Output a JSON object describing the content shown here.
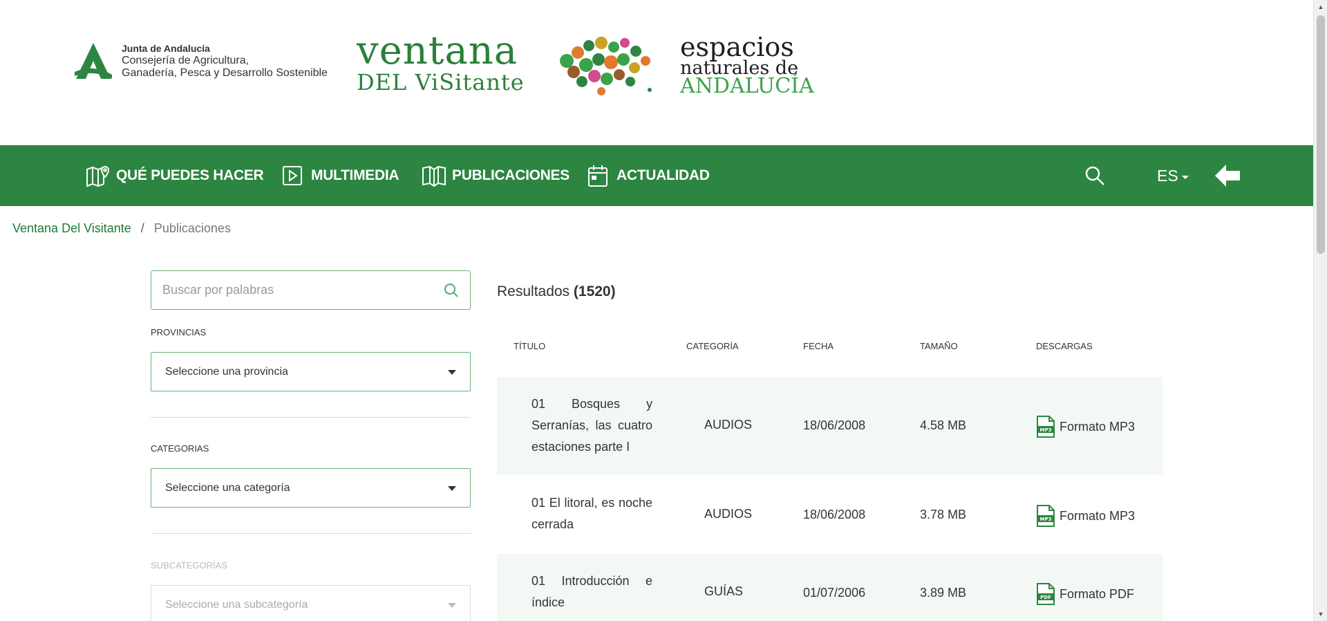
{
  "header": {
    "junta_line1": "Junta de Andalucía",
    "junta_line2": "Consejería de Agricultura,",
    "junta_line3": "Ganadería, Pesca y Desarrollo Sostenible",
    "ventana_line1": "ventana",
    "ventana_line2": "DEL ViSitante",
    "espacios_line1": "espacios",
    "espacios_line2": "naturales de",
    "espacios_line3": "ANDALUCÍA"
  },
  "nav": {
    "items": [
      {
        "label": "QUÉ PUEDES HACER",
        "icon": "map-pin-icon"
      },
      {
        "label": "MULTIMEDIA",
        "icon": "play-icon"
      },
      {
        "label": "PUBLICACIONES",
        "icon": "book-icon"
      },
      {
        "label": "ACTUALIDAD",
        "icon": "calendar-icon"
      }
    ],
    "language": "ES",
    "search_icon": "search-icon",
    "back_icon": "arrow-left-icon"
  },
  "breadcrumb": {
    "home": "Ventana Del Visitante",
    "separator": "/",
    "current": "Publicaciones"
  },
  "sidebar": {
    "search_placeholder": "Buscar por palabras",
    "provincias_label": "PROVINCIAS",
    "provincias_value": "Seleccione una provincia",
    "categorias_label": "CATEGORIAS",
    "categorias_value": "Seleccione una categoría",
    "subcategorias_label": "SUBCATEGORÍAS",
    "subcategorias_value": "Seleccione una subcategoría"
  },
  "results": {
    "label": "Resultados",
    "count": "(1520)",
    "columns": [
      "TÍTULO",
      "CATEGORÍA",
      "FECHA",
      "TAMAÑO",
      "DESCARGAS"
    ],
    "rows": [
      {
        "title": "01 Bosques y Serranías, las cuatro estaciones parte I",
        "category": "AUDIOS",
        "date": "18/06/2008",
        "size": "4.58 MB",
        "download": "Formato MP3",
        "file_type": "MP3"
      },
      {
        "title": "01 El litoral, es noche cerrada",
        "category": "AUDIOS",
        "date": "18/06/2008",
        "size": "3.78 MB",
        "download": "Formato MP3",
        "file_type": "MP3"
      },
      {
        "title": "01 Introducción e índice",
        "category": "GUÍAS",
        "date": "01/07/2006",
        "size": "3.89 MB",
        "download": "Formato PDF",
        "file_type": "PDF"
      }
    ]
  },
  "colors": {
    "brand_green": "#2c8641",
    "row_shade": "#f3f8f4"
  }
}
